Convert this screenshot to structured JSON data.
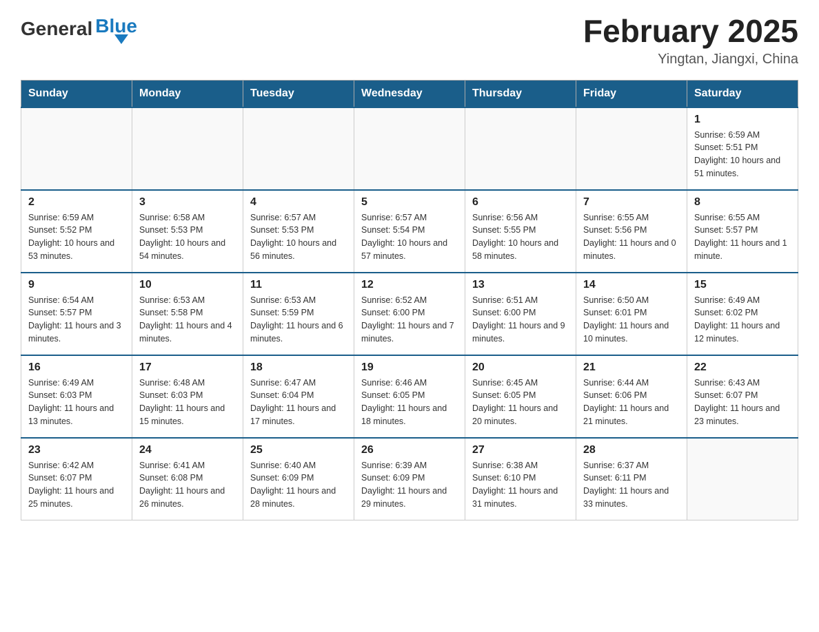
{
  "header": {
    "logo_general": "General",
    "logo_blue": "Blue",
    "month_title": "February 2025",
    "location": "Yingtan, Jiangxi, China"
  },
  "days_of_week": [
    "Sunday",
    "Monday",
    "Tuesday",
    "Wednesday",
    "Thursday",
    "Friday",
    "Saturday"
  ],
  "weeks": [
    {
      "days": [
        {
          "num": "",
          "sunrise": "",
          "sunset": "",
          "daylight": "",
          "empty": true
        },
        {
          "num": "",
          "sunrise": "",
          "sunset": "",
          "daylight": "",
          "empty": true
        },
        {
          "num": "",
          "sunrise": "",
          "sunset": "",
          "daylight": "",
          "empty": true
        },
        {
          "num": "",
          "sunrise": "",
          "sunset": "",
          "daylight": "",
          "empty": true
        },
        {
          "num": "",
          "sunrise": "",
          "sunset": "",
          "daylight": "",
          "empty": true
        },
        {
          "num": "",
          "sunrise": "",
          "sunset": "",
          "daylight": "",
          "empty": true
        },
        {
          "num": "1",
          "sunrise": "Sunrise: 6:59 AM",
          "sunset": "Sunset: 5:51 PM",
          "daylight": "Daylight: 10 hours and 51 minutes.",
          "empty": false
        }
      ]
    },
    {
      "days": [
        {
          "num": "2",
          "sunrise": "Sunrise: 6:59 AM",
          "sunset": "Sunset: 5:52 PM",
          "daylight": "Daylight: 10 hours and 53 minutes.",
          "empty": false
        },
        {
          "num": "3",
          "sunrise": "Sunrise: 6:58 AM",
          "sunset": "Sunset: 5:53 PM",
          "daylight": "Daylight: 10 hours and 54 minutes.",
          "empty": false
        },
        {
          "num": "4",
          "sunrise": "Sunrise: 6:57 AM",
          "sunset": "Sunset: 5:53 PM",
          "daylight": "Daylight: 10 hours and 56 minutes.",
          "empty": false
        },
        {
          "num": "5",
          "sunrise": "Sunrise: 6:57 AM",
          "sunset": "Sunset: 5:54 PM",
          "daylight": "Daylight: 10 hours and 57 minutes.",
          "empty": false
        },
        {
          "num": "6",
          "sunrise": "Sunrise: 6:56 AM",
          "sunset": "Sunset: 5:55 PM",
          "daylight": "Daylight: 10 hours and 58 minutes.",
          "empty": false
        },
        {
          "num": "7",
          "sunrise": "Sunrise: 6:55 AM",
          "sunset": "Sunset: 5:56 PM",
          "daylight": "Daylight: 11 hours and 0 minutes.",
          "empty": false
        },
        {
          "num": "8",
          "sunrise": "Sunrise: 6:55 AM",
          "sunset": "Sunset: 5:57 PM",
          "daylight": "Daylight: 11 hours and 1 minute.",
          "empty": false
        }
      ]
    },
    {
      "days": [
        {
          "num": "9",
          "sunrise": "Sunrise: 6:54 AM",
          "sunset": "Sunset: 5:57 PM",
          "daylight": "Daylight: 11 hours and 3 minutes.",
          "empty": false
        },
        {
          "num": "10",
          "sunrise": "Sunrise: 6:53 AM",
          "sunset": "Sunset: 5:58 PM",
          "daylight": "Daylight: 11 hours and 4 minutes.",
          "empty": false
        },
        {
          "num": "11",
          "sunrise": "Sunrise: 6:53 AM",
          "sunset": "Sunset: 5:59 PM",
          "daylight": "Daylight: 11 hours and 6 minutes.",
          "empty": false
        },
        {
          "num": "12",
          "sunrise": "Sunrise: 6:52 AM",
          "sunset": "Sunset: 6:00 PM",
          "daylight": "Daylight: 11 hours and 7 minutes.",
          "empty": false
        },
        {
          "num": "13",
          "sunrise": "Sunrise: 6:51 AM",
          "sunset": "Sunset: 6:00 PM",
          "daylight": "Daylight: 11 hours and 9 minutes.",
          "empty": false
        },
        {
          "num": "14",
          "sunrise": "Sunrise: 6:50 AM",
          "sunset": "Sunset: 6:01 PM",
          "daylight": "Daylight: 11 hours and 10 minutes.",
          "empty": false
        },
        {
          "num": "15",
          "sunrise": "Sunrise: 6:49 AM",
          "sunset": "Sunset: 6:02 PM",
          "daylight": "Daylight: 11 hours and 12 minutes.",
          "empty": false
        }
      ]
    },
    {
      "days": [
        {
          "num": "16",
          "sunrise": "Sunrise: 6:49 AM",
          "sunset": "Sunset: 6:03 PM",
          "daylight": "Daylight: 11 hours and 13 minutes.",
          "empty": false
        },
        {
          "num": "17",
          "sunrise": "Sunrise: 6:48 AM",
          "sunset": "Sunset: 6:03 PM",
          "daylight": "Daylight: 11 hours and 15 minutes.",
          "empty": false
        },
        {
          "num": "18",
          "sunrise": "Sunrise: 6:47 AM",
          "sunset": "Sunset: 6:04 PM",
          "daylight": "Daylight: 11 hours and 17 minutes.",
          "empty": false
        },
        {
          "num": "19",
          "sunrise": "Sunrise: 6:46 AM",
          "sunset": "Sunset: 6:05 PM",
          "daylight": "Daylight: 11 hours and 18 minutes.",
          "empty": false
        },
        {
          "num": "20",
          "sunrise": "Sunrise: 6:45 AM",
          "sunset": "Sunset: 6:05 PM",
          "daylight": "Daylight: 11 hours and 20 minutes.",
          "empty": false
        },
        {
          "num": "21",
          "sunrise": "Sunrise: 6:44 AM",
          "sunset": "Sunset: 6:06 PM",
          "daylight": "Daylight: 11 hours and 21 minutes.",
          "empty": false
        },
        {
          "num": "22",
          "sunrise": "Sunrise: 6:43 AM",
          "sunset": "Sunset: 6:07 PM",
          "daylight": "Daylight: 11 hours and 23 minutes.",
          "empty": false
        }
      ]
    },
    {
      "days": [
        {
          "num": "23",
          "sunrise": "Sunrise: 6:42 AM",
          "sunset": "Sunset: 6:07 PM",
          "daylight": "Daylight: 11 hours and 25 minutes.",
          "empty": false
        },
        {
          "num": "24",
          "sunrise": "Sunrise: 6:41 AM",
          "sunset": "Sunset: 6:08 PM",
          "daylight": "Daylight: 11 hours and 26 minutes.",
          "empty": false
        },
        {
          "num": "25",
          "sunrise": "Sunrise: 6:40 AM",
          "sunset": "Sunset: 6:09 PM",
          "daylight": "Daylight: 11 hours and 28 minutes.",
          "empty": false
        },
        {
          "num": "26",
          "sunrise": "Sunrise: 6:39 AM",
          "sunset": "Sunset: 6:09 PM",
          "daylight": "Daylight: 11 hours and 29 minutes.",
          "empty": false
        },
        {
          "num": "27",
          "sunrise": "Sunrise: 6:38 AM",
          "sunset": "Sunset: 6:10 PM",
          "daylight": "Daylight: 11 hours and 31 minutes.",
          "empty": false
        },
        {
          "num": "28",
          "sunrise": "Sunrise: 6:37 AM",
          "sunset": "Sunset: 6:11 PM",
          "daylight": "Daylight: 11 hours and 33 minutes.",
          "empty": false
        },
        {
          "num": "",
          "sunrise": "",
          "sunset": "",
          "daylight": "",
          "empty": true
        }
      ]
    }
  ]
}
